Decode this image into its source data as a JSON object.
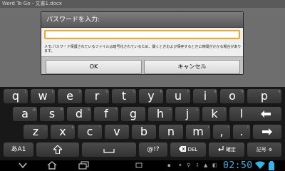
{
  "app": {
    "title": "Word To Go - 文書1.docx"
  },
  "dialog": {
    "title": "パスワードを入力:",
    "password_value": "",
    "message": "メモ:パスワード保護されているファイルは暗号化されているため、開くときおよび保存するときに時間がかかる場合があります。",
    "ok_label": "OK",
    "cancel_label": "キャンセル"
  },
  "keyboard": {
    "row1": [
      {
        "label": "q",
        "hint": "1"
      },
      {
        "label": "w",
        "hint": "2"
      },
      {
        "label": "e",
        "hint": "3"
      },
      {
        "label": "r",
        "hint": "4"
      },
      {
        "label": "t",
        "hint": "5"
      },
      {
        "label": "y",
        "hint": "6"
      },
      {
        "label": "u",
        "hint": "7"
      },
      {
        "label": "i",
        "hint": "8"
      },
      {
        "label": "o",
        "hint": "9"
      },
      {
        "label": "p",
        "hint": "0"
      }
    ],
    "row2": [
      {
        "label": "a",
        "hint": "@"
      },
      {
        "label": "s",
        "hint": "#"
      },
      {
        "label": "d",
        "hint": "&"
      },
      {
        "label": "f",
        "hint": "*"
      },
      {
        "label": "g",
        "hint": "-"
      },
      {
        "label": "h",
        "hint": "+"
      },
      {
        "label": "j",
        "hint": "="
      },
      {
        "label": "k",
        "hint": "("
      },
      {
        "label": "l",
        "hint": ")"
      }
    ],
    "row3": [
      {
        "label": "z",
        "hint": "_"
      },
      {
        "label": "x",
        "hint": "$"
      },
      {
        "label": "c",
        "hint": "\""
      },
      {
        "label": "v",
        "hint": "'"
      },
      {
        "label": "b",
        "hint": ":"
      },
      {
        "label": "n",
        "hint": ";"
      },
      {
        "label": "m",
        "hint": "/"
      },
      {
        "label": ",",
        "hint": "!"
      },
      {
        "label": ".",
        "hint": "?"
      }
    ],
    "input_mode_label": "あA1",
    "symbols_label": "@!?",
    "delete_label": "DEL",
    "enter_label": "確定",
    "kigou_label": "記号"
  },
  "status": {
    "time": "02:50"
  },
  "colors": {
    "input_focus": "#f5a623",
    "clock": "#33b5e5",
    "battery": "#33b5e5"
  }
}
